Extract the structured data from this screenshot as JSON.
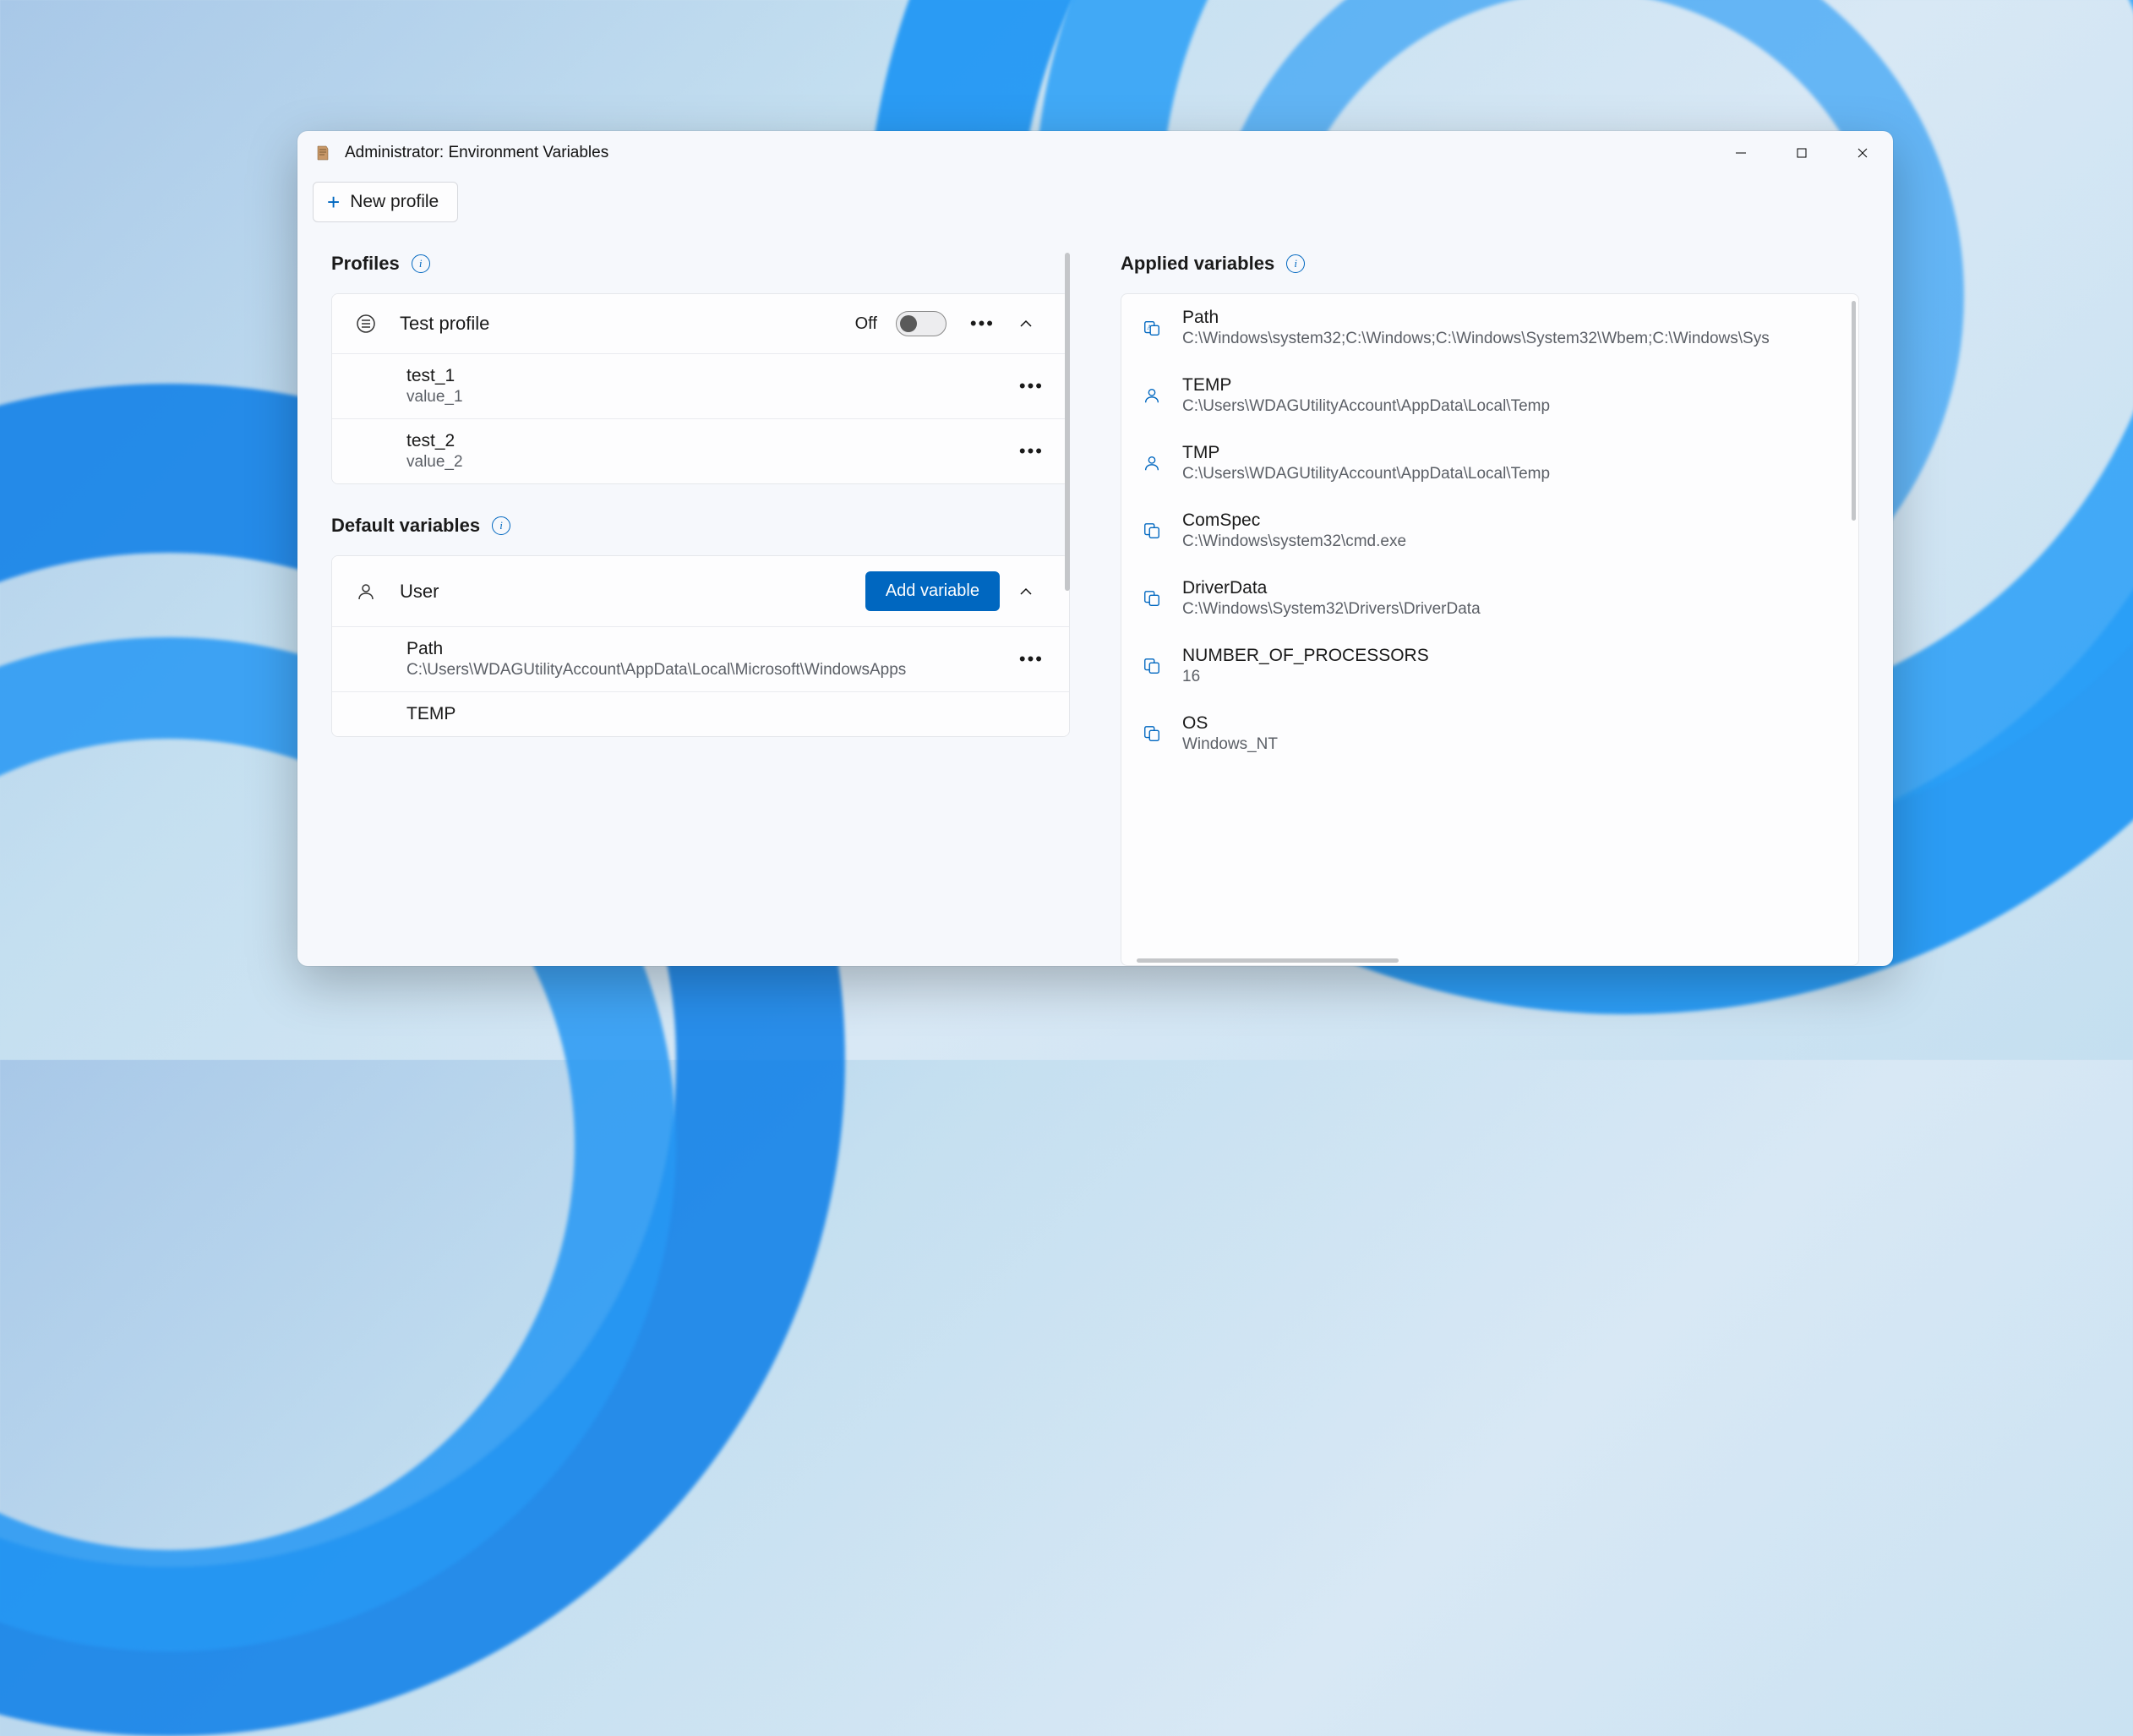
{
  "window": {
    "title": "Administrator: Environment Variables"
  },
  "toolbar": {
    "new_profile_label": "New profile"
  },
  "sections": {
    "profiles_title": "Profiles",
    "default_vars_title": "Default variables",
    "applied_title": "Applied variables"
  },
  "profile": {
    "name": "Test profile",
    "toggle_label": "Off",
    "vars": [
      {
        "name": "test_1",
        "value": "value_1"
      },
      {
        "name": "test_2",
        "value": "value_2"
      }
    ]
  },
  "default_user": {
    "header": "User",
    "add_label": "Add variable",
    "vars": [
      {
        "name": "Path",
        "value": "C:\\Users\\WDAGUtilityAccount\\AppData\\Local\\Microsoft\\WindowsApps"
      },
      {
        "name": "TEMP",
        "value": ""
      }
    ]
  },
  "applied": [
    {
      "icon": "override",
      "name": "Path",
      "value": "C:\\Windows\\system32;C:\\Windows;C:\\Windows\\System32\\Wbem;C:\\Windows\\Sys"
    },
    {
      "icon": "user",
      "name": "TEMP",
      "value": "C:\\Users\\WDAGUtilityAccount\\AppData\\Local\\Temp"
    },
    {
      "icon": "user",
      "name": "TMP",
      "value": "C:\\Users\\WDAGUtilityAccount\\AppData\\Local\\Temp"
    },
    {
      "icon": "system",
      "name": "ComSpec",
      "value": "C:\\Windows\\system32\\cmd.exe"
    },
    {
      "icon": "system",
      "name": "DriverData",
      "value": "C:\\Windows\\System32\\Drivers\\DriverData"
    },
    {
      "icon": "system",
      "name": "NUMBER_OF_PROCESSORS",
      "value": "16"
    },
    {
      "icon": "system",
      "name": "OS",
      "value": "Windows_NT"
    }
  ]
}
